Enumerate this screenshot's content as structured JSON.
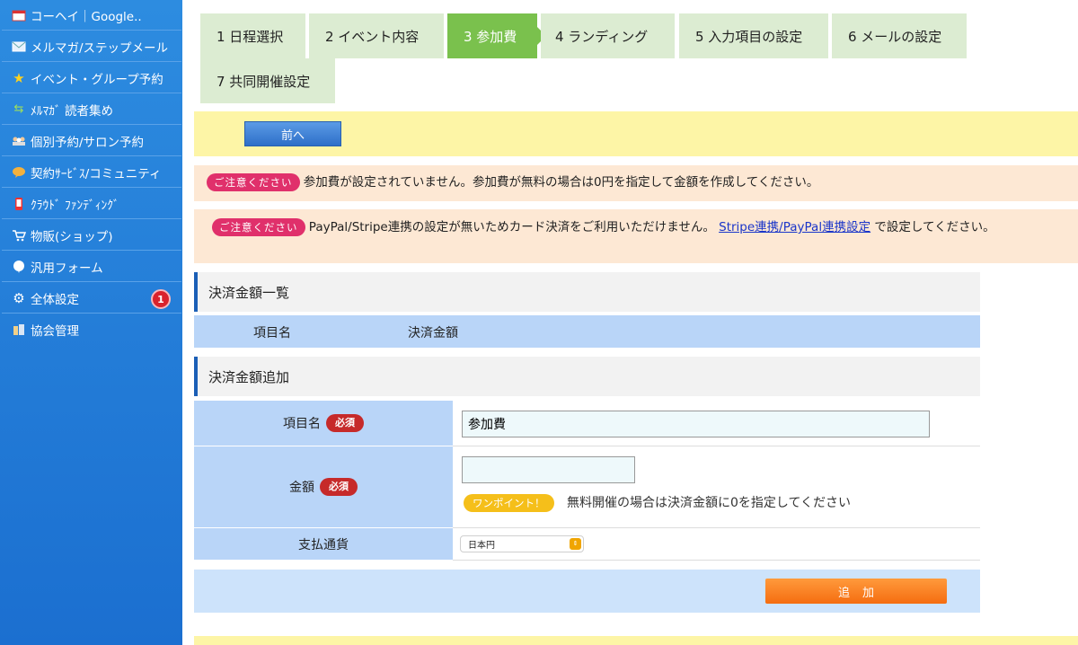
{
  "sidebar": {
    "items": [
      {
        "label": "コーヘイ｜Google..",
        "icon": "calendar-icon"
      },
      {
        "label": "メルマガ/ステップメール",
        "icon": "envelope-icon"
      },
      {
        "label": "イベント・グループ予約",
        "icon": "star-icon"
      },
      {
        "label": "ﾒﾙﾏｶﾞ 読者集め",
        "icon": "arrows-icon"
      },
      {
        "label": "個別予約/サロン予約",
        "icon": "people-icon"
      },
      {
        "label": "契約ｻｰﾋﾞｽ/コミュニティ",
        "icon": "chat-icon"
      },
      {
        "label": "ｸﾗｳﾄﾞ ﾌｧﾝﾃﾞｨﾝｸﾞ",
        "icon": "phone-icon"
      },
      {
        "label": "物販(ショップ)",
        "icon": "cart-icon"
      },
      {
        "label": "汎用フォーム",
        "icon": "bubble-icon"
      },
      {
        "label": "全体設定",
        "icon": "gear-icon",
        "badge": "1"
      },
      {
        "label": "協会管理",
        "icon": "building-icon"
      }
    ],
    "badge_color": "#d9232d"
  },
  "steps": [
    {
      "label": "1 日程選択"
    },
    {
      "label": "2 イベント内容"
    },
    {
      "label": "3 参加費",
      "active": true
    },
    {
      "label": "4 ランディング"
    },
    {
      "label": "5 入力項目の設定"
    },
    {
      "label": "6 メールの設定"
    },
    {
      "label": "7 共同開催設定"
    }
  ],
  "toolbar": {
    "prev_label": "前へ"
  },
  "notices": {
    "pill_label": "ご注意ください",
    "first": "参加費が設定されていません。参加費が無料の場合は0円を指定して金額を作成してください。",
    "second_before": "PayPal/Stripe連携の設定が無いためカード決済をご利用いただけません。",
    "second_link": "Stripe連携/PayPal連携設定",
    "second_after": "で設定してください。"
  },
  "payment_list": {
    "title": "決済金額一覧",
    "columns": [
      "項目名",
      "決済金額"
    ]
  },
  "payment_add": {
    "title": "決済金額追加",
    "required_label": "必須",
    "item_name_label": "項目名",
    "item_name_value": "参加費",
    "amount_label": "金額",
    "amount_value": "",
    "tip_label": "ワンポイント！",
    "tip_text": "無料開催の場合は決済金額に0を指定してください",
    "currency_label": "支払通貨",
    "currency_value": "日本円",
    "add_label": "追加"
  },
  "colors": {
    "accent": "#1c5fb6",
    "step_active": "#7ac14d",
    "step_inactive": "#dcecd2",
    "notice_bg": "#fde8d4",
    "required_pill": "#c62a2a",
    "add_button": "#f56d10"
  }
}
